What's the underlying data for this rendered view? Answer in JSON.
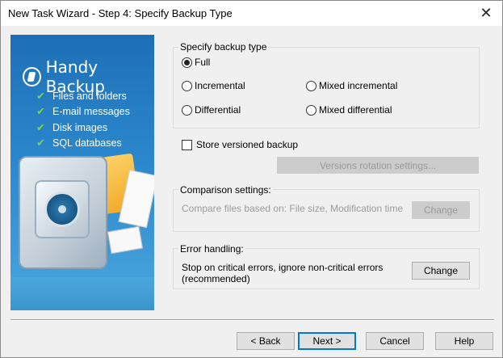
{
  "window": {
    "title": "New Task Wizard - Step 4: Specify Backup Type",
    "close_label": "✕"
  },
  "banner": {
    "brand": "Handy Backup",
    "features": [
      "Files and folders",
      "E-mail messages",
      "Disk images",
      "SQL databases"
    ],
    "check_glyph": "✔"
  },
  "backup_type": {
    "legend": "Specify backup type",
    "options": {
      "full": "Full",
      "incremental": "Incremental",
      "mixed_incremental": "Mixed incremental",
      "differential": "Differential",
      "mixed_differential": "Mixed differential"
    },
    "selected": "full"
  },
  "versioned": {
    "checkbox_label": "Store versioned backup",
    "checked": false,
    "rotation_button": "Versions rotation settings..."
  },
  "comparison": {
    "legend": "Comparison settings:",
    "description": "Compare files based on: File size, Modification time",
    "change_button": "Change"
  },
  "error_handling": {
    "legend": "Error handling:",
    "description_line1": "Stop on critical errors, ignore non-critical errors",
    "description_line2": "(recommended)",
    "change_button": "Change"
  },
  "footer": {
    "back": "< Back",
    "next": "Next >",
    "cancel": "Cancel",
    "help": "Help"
  },
  "colors": {
    "banner_top": "#1e6fb5",
    "banner_bottom": "#4aa7dd",
    "check_green": "#7ed44a",
    "default_button_border": "#0078d7"
  }
}
